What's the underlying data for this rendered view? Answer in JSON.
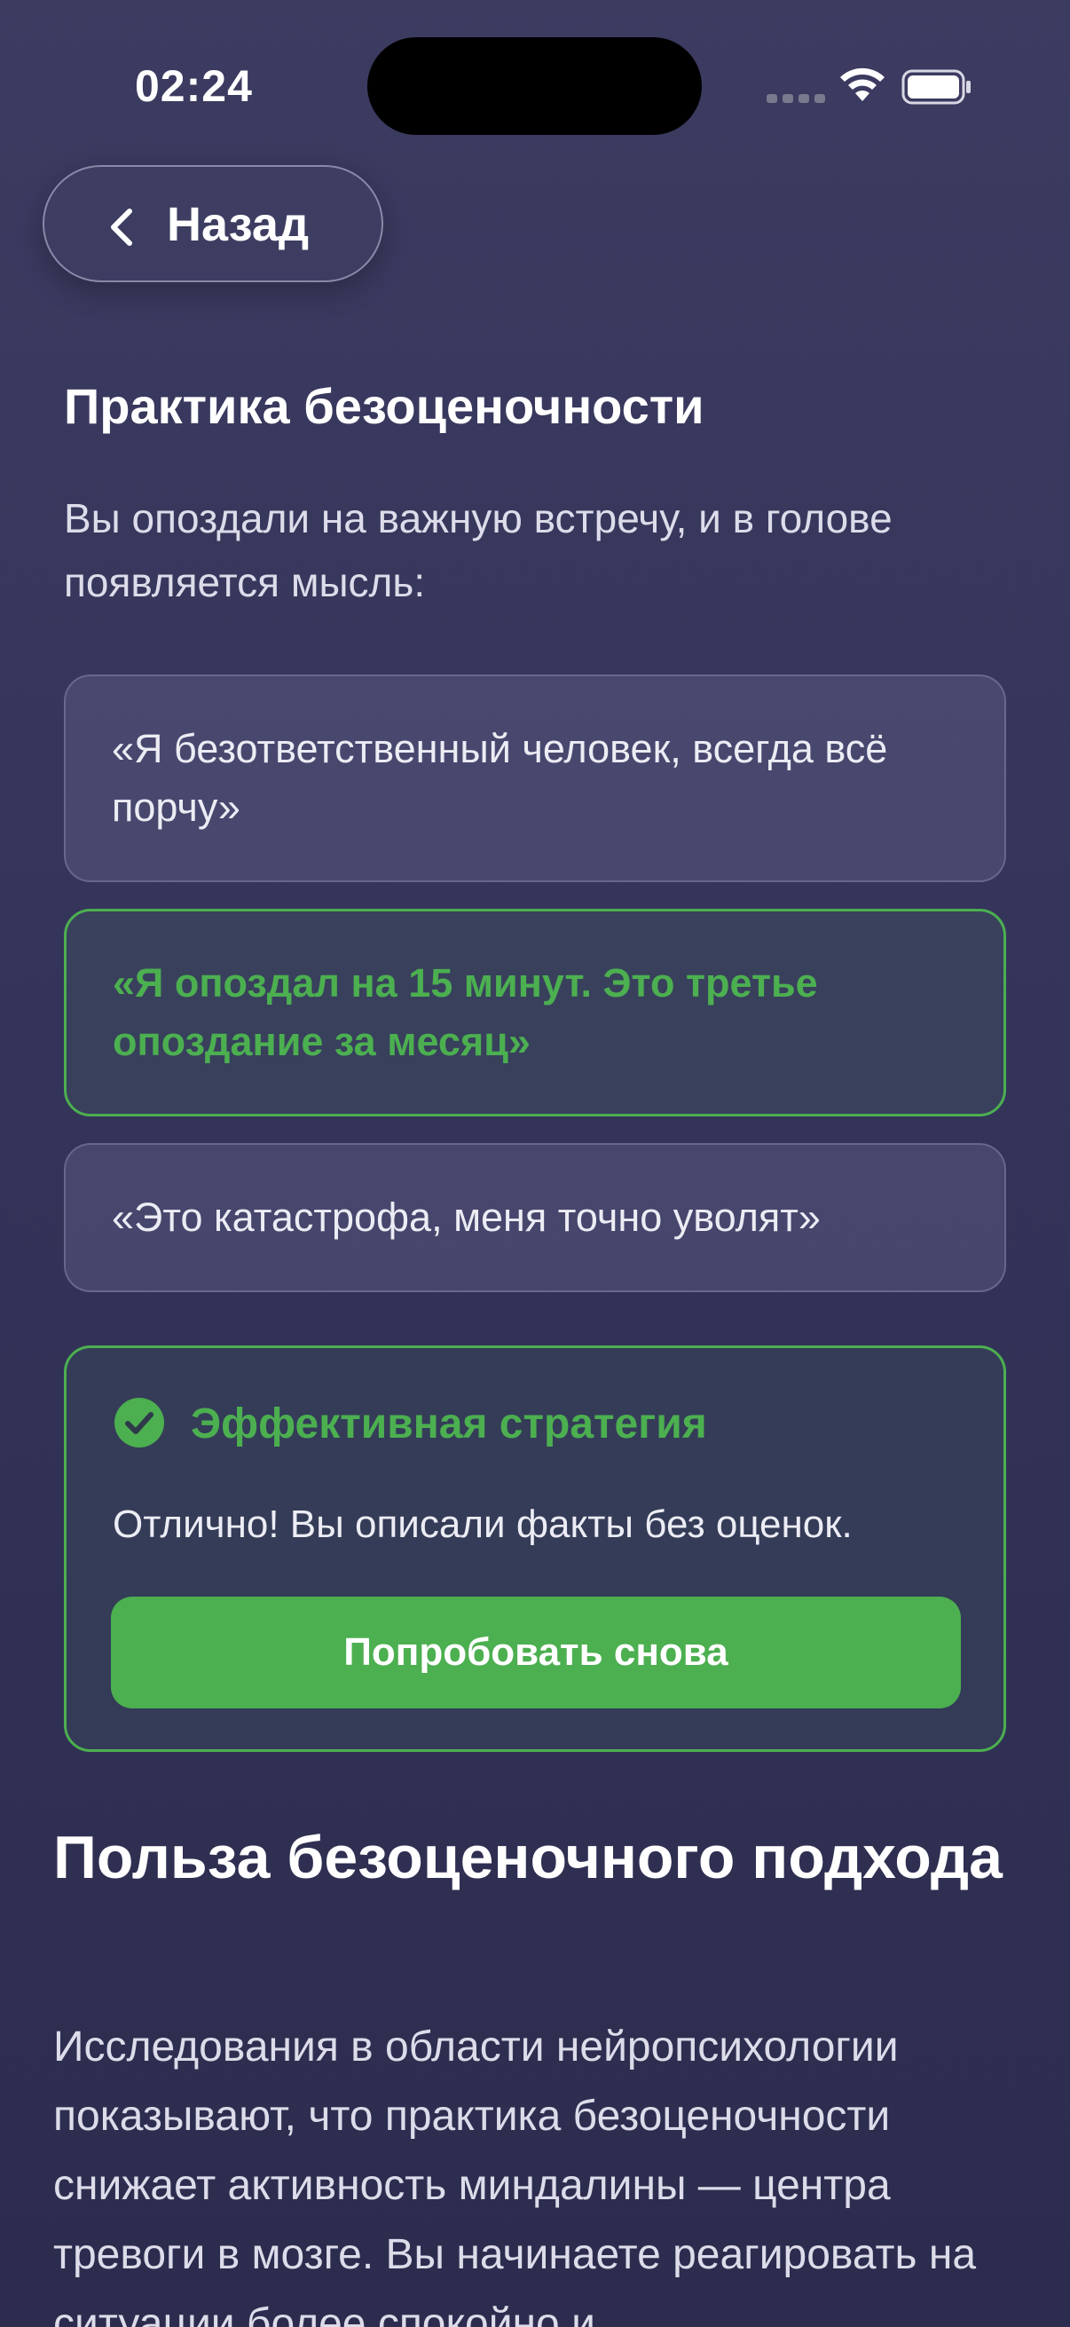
{
  "status_bar": {
    "time": "02:24"
  },
  "header": {
    "back_label": "Назад"
  },
  "exercise": {
    "title": "Практика безоценочности",
    "prompt": "Вы опоздали на важную встречу, и в голове появляется мысль:",
    "options": [
      {
        "text": "«Я безответственный человек, всегда всё порчу»",
        "state": "neutral"
      },
      {
        "text": "«Я опоздал на 15 минут. Это третье опоздание за месяц»",
        "state": "correct"
      },
      {
        "text": "«Это катастрофа, меня точно уволят»",
        "state": "neutral"
      }
    ]
  },
  "feedback": {
    "title": "Эффективная стратегия",
    "message": "Отлично! Вы описали факты без оценок.",
    "retry_label": "Попробовать снова",
    "icon": "check-circle-icon"
  },
  "benefits": {
    "title": "Польза безоценочного подхода",
    "body": "Исследования в области нейропсихологии показывают, что практика безоценочности снижает активность миндалины — центра тревоги в мозге. Вы начинаете реагировать на ситуации более спокойно и"
  },
  "colors": {
    "accent_green": "#4caf50",
    "background": "#36365a"
  }
}
